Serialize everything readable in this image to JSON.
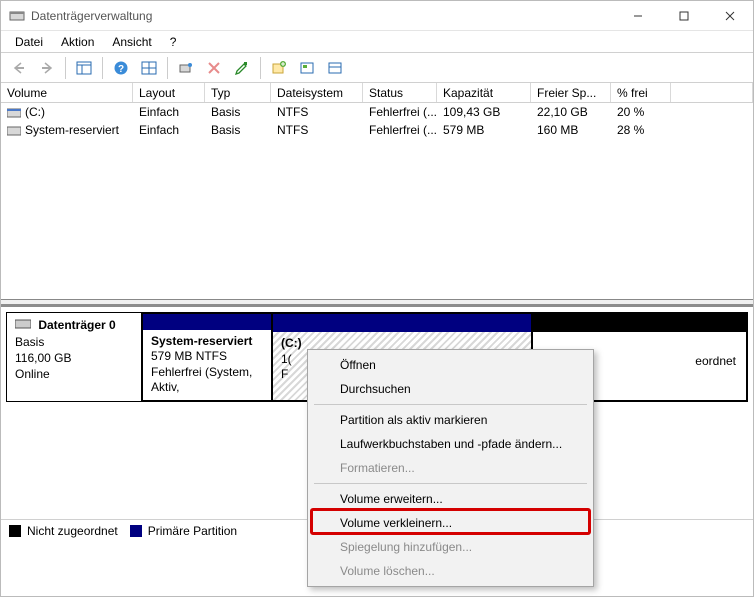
{
  "window": {
    "title": "Datenträgerverwaltung"
  },
  "menu": {
    "items": [
      "Datei",
      "Aktion",
      "Ansicht",
      "?"
    ]
  },
  "volumeTable": {
    "headers": {
      "volume": "Volume",
      "layout": "Layout",
      "typ": "Typ",
      "fs": "Dateisystem",
      "status": "Status",
      "cap": "Kapazität",
      "free": "Freier Sp...",
      "pct": "% frei"
    },
    "rows": [
      {
        "volume": "(C:)",
        "layout": "Einfach",
        "typ": "Basis",
        "fs": "NTFS",
        "status": "Fehlerfrei (...",
        "cap": "109,43 GB",
        "free": "22,10 GB",
        "pct": "20 %"
      },
      {
        "volume": "System-reserviert",
        "layout": "Einfach",
        "typ": "Basis",
        "fs": "NTFS",
        "status": "Fehlerfrei (...",
        "cap": "579 MB",
        "free": "160 MB",
        "pct": "28 %"
      }
    ]
  },
  "disk": {
    "name": "Datenträger 0",
    "type": "Basis",
    "size": "116,00 GB",
    "state": "Online",
    "parts": {
      "sys": {
        "title": "System-reserviert",
        "line2": "579 MB NTFS",
        "line3": "Fehlerfrei (System, Aktiv,"
      },
      "c": {
        "title": "(C:)",
        "line2": "1("
      },
      "none": {
        "line2": "eordnet"
      }
    }
  },
  "legend": {
    "unalloc": "Nicht zugeordnet",
    "primary": "Primäre Partition"
  },
  "contextMenu": {
    "open": "Öffnen",
    "browse": "Durchsuchen",
    "markActive": "Partition als aktiv markieren",
    "changeLetter": "Laufwerkbuchstaben und -pfade ändern...",
    "format": "Formatieren...",
    "extend": "Volume erweitern...",
    "shrink": "Volume verkleinern...",
    "mirror": "Spiegelung hinzufügen...",
    "delete": "Volume löschen..."
  }
}
